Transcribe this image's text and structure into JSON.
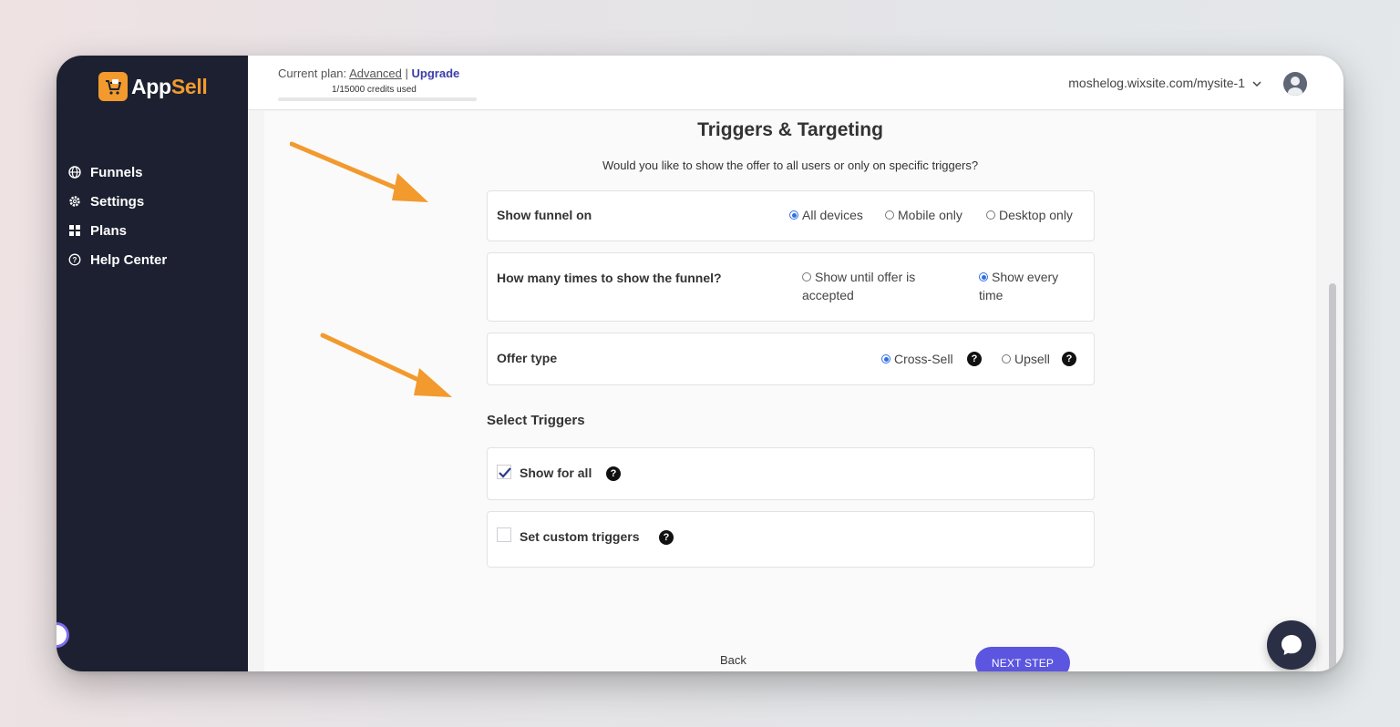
{
  "brand": {
    "app": "App",
    "sell": "Sell"
  },
  "nav": [
    {
      "label": "Funnels",
      "icon": "globe-icon"
    },
    {
      "label": "Settings",
      "icon": "gear-icon"
    },
    {
      "label": "Plans",
      "icon": "grid-icon"
    },
    {
      "label": "Help Center",
      "icon": "help-circle-icon"
    }
  ],
  "topbar": {
    "plan_prefix": "Current plan:",
    "plan_name": "Advanced",
    "separator": "|",
    "upgrade": "Upgrade",
    "credits": "1/15000 credits used",
    "site": "moshelog.wixsite.com/mysite-1"
  },
  "page": {
    "title": "Triggers & Targeting",
    "subtitle": "Would you like to show the offer to all users or only on specific triggers?"
  },
  "show_funnel": {
    "label": "Show funnel on",
    "options": [
      "All devices",
      "Mobile only",
      "Desktop only"
    ],
    "selected": "All devices"
  },
  "frequency": {
    "label": "How many times to show the funnel?",
    "option1_line1": "Show until offer is",
    "option1_line2": "accepted",
    "option2_line1": "Show every",
    "option2_line2": "time",
    "selected": "Show every time"
  },
  "offer_type": {
    "label": "Offer type",
    "options": [
      "Cross-Sell",
      "Upsell"
    ],
    "selected": "Cross-Sell"
  },
  "triggers": {
    "heading": "Select Triggers",
    "show_for_all": "Show for all",
    "show_for_all_checked": true,
    "custom": "Set custom triggers",
    "custom_checked": false
  },
  "actions": {
    "back": "Back",
    "next": "NEXT STEP"
  },
  "colors": {
    "sidebar": "#1c2030",
    "accent": "#5b55e0",
    "brand_orange": "#f29a2e",
    "radio_selected": "#2f6fe3",
    "annotation_arrow": "#f29a2e"
  }
}
